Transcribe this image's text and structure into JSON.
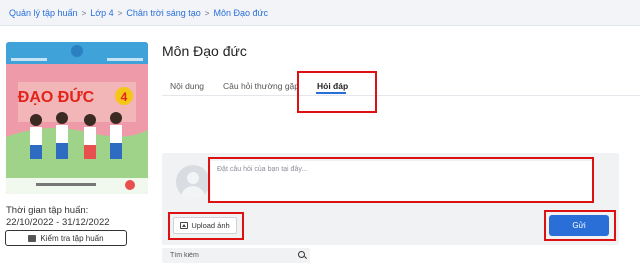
{
  "breadcrumb": {
    "items": [
      "Quản lý tập huấn",
      "Lớp 4",
      "Chân trời sáng tạo",
      "Môn Đạo đức"
    ],
    "separator": ">"
  },
  "book": {
    "cover_title": "ĐẠO ĐỨC",
    "grade": "4",
    "period_label": "Thời gian tập huấn:",
    "period_value": "22/10/2022 - 31/12/2022",
    "check_button": "Kiểm tra tập huấn"
  },
  "page_title": "Môn Đạo đức",
  "tabs": [
    {
      "label": "Nội dung",
      "active": false
    },
    {
      "label": "Câu hỏi thường gặp",
      "active": false
    },
    {
      "label": "Hỏi đáp",
      "active": true
    }
  ],
  "question": {
    "placeholder": "Đặt câu hỏi của bạn tại đây...",
    "upload_label": "Upload ảnh",
    "send_label": "Gửi"
  },
  "search": {
    "placeholder": "Tìm kiếm"
  },
  "colors": {
    "accent": "#2a6fd8",
    "highlight": "#d11111",
    "cover_pink": "#ef9aa8"
  }
}
